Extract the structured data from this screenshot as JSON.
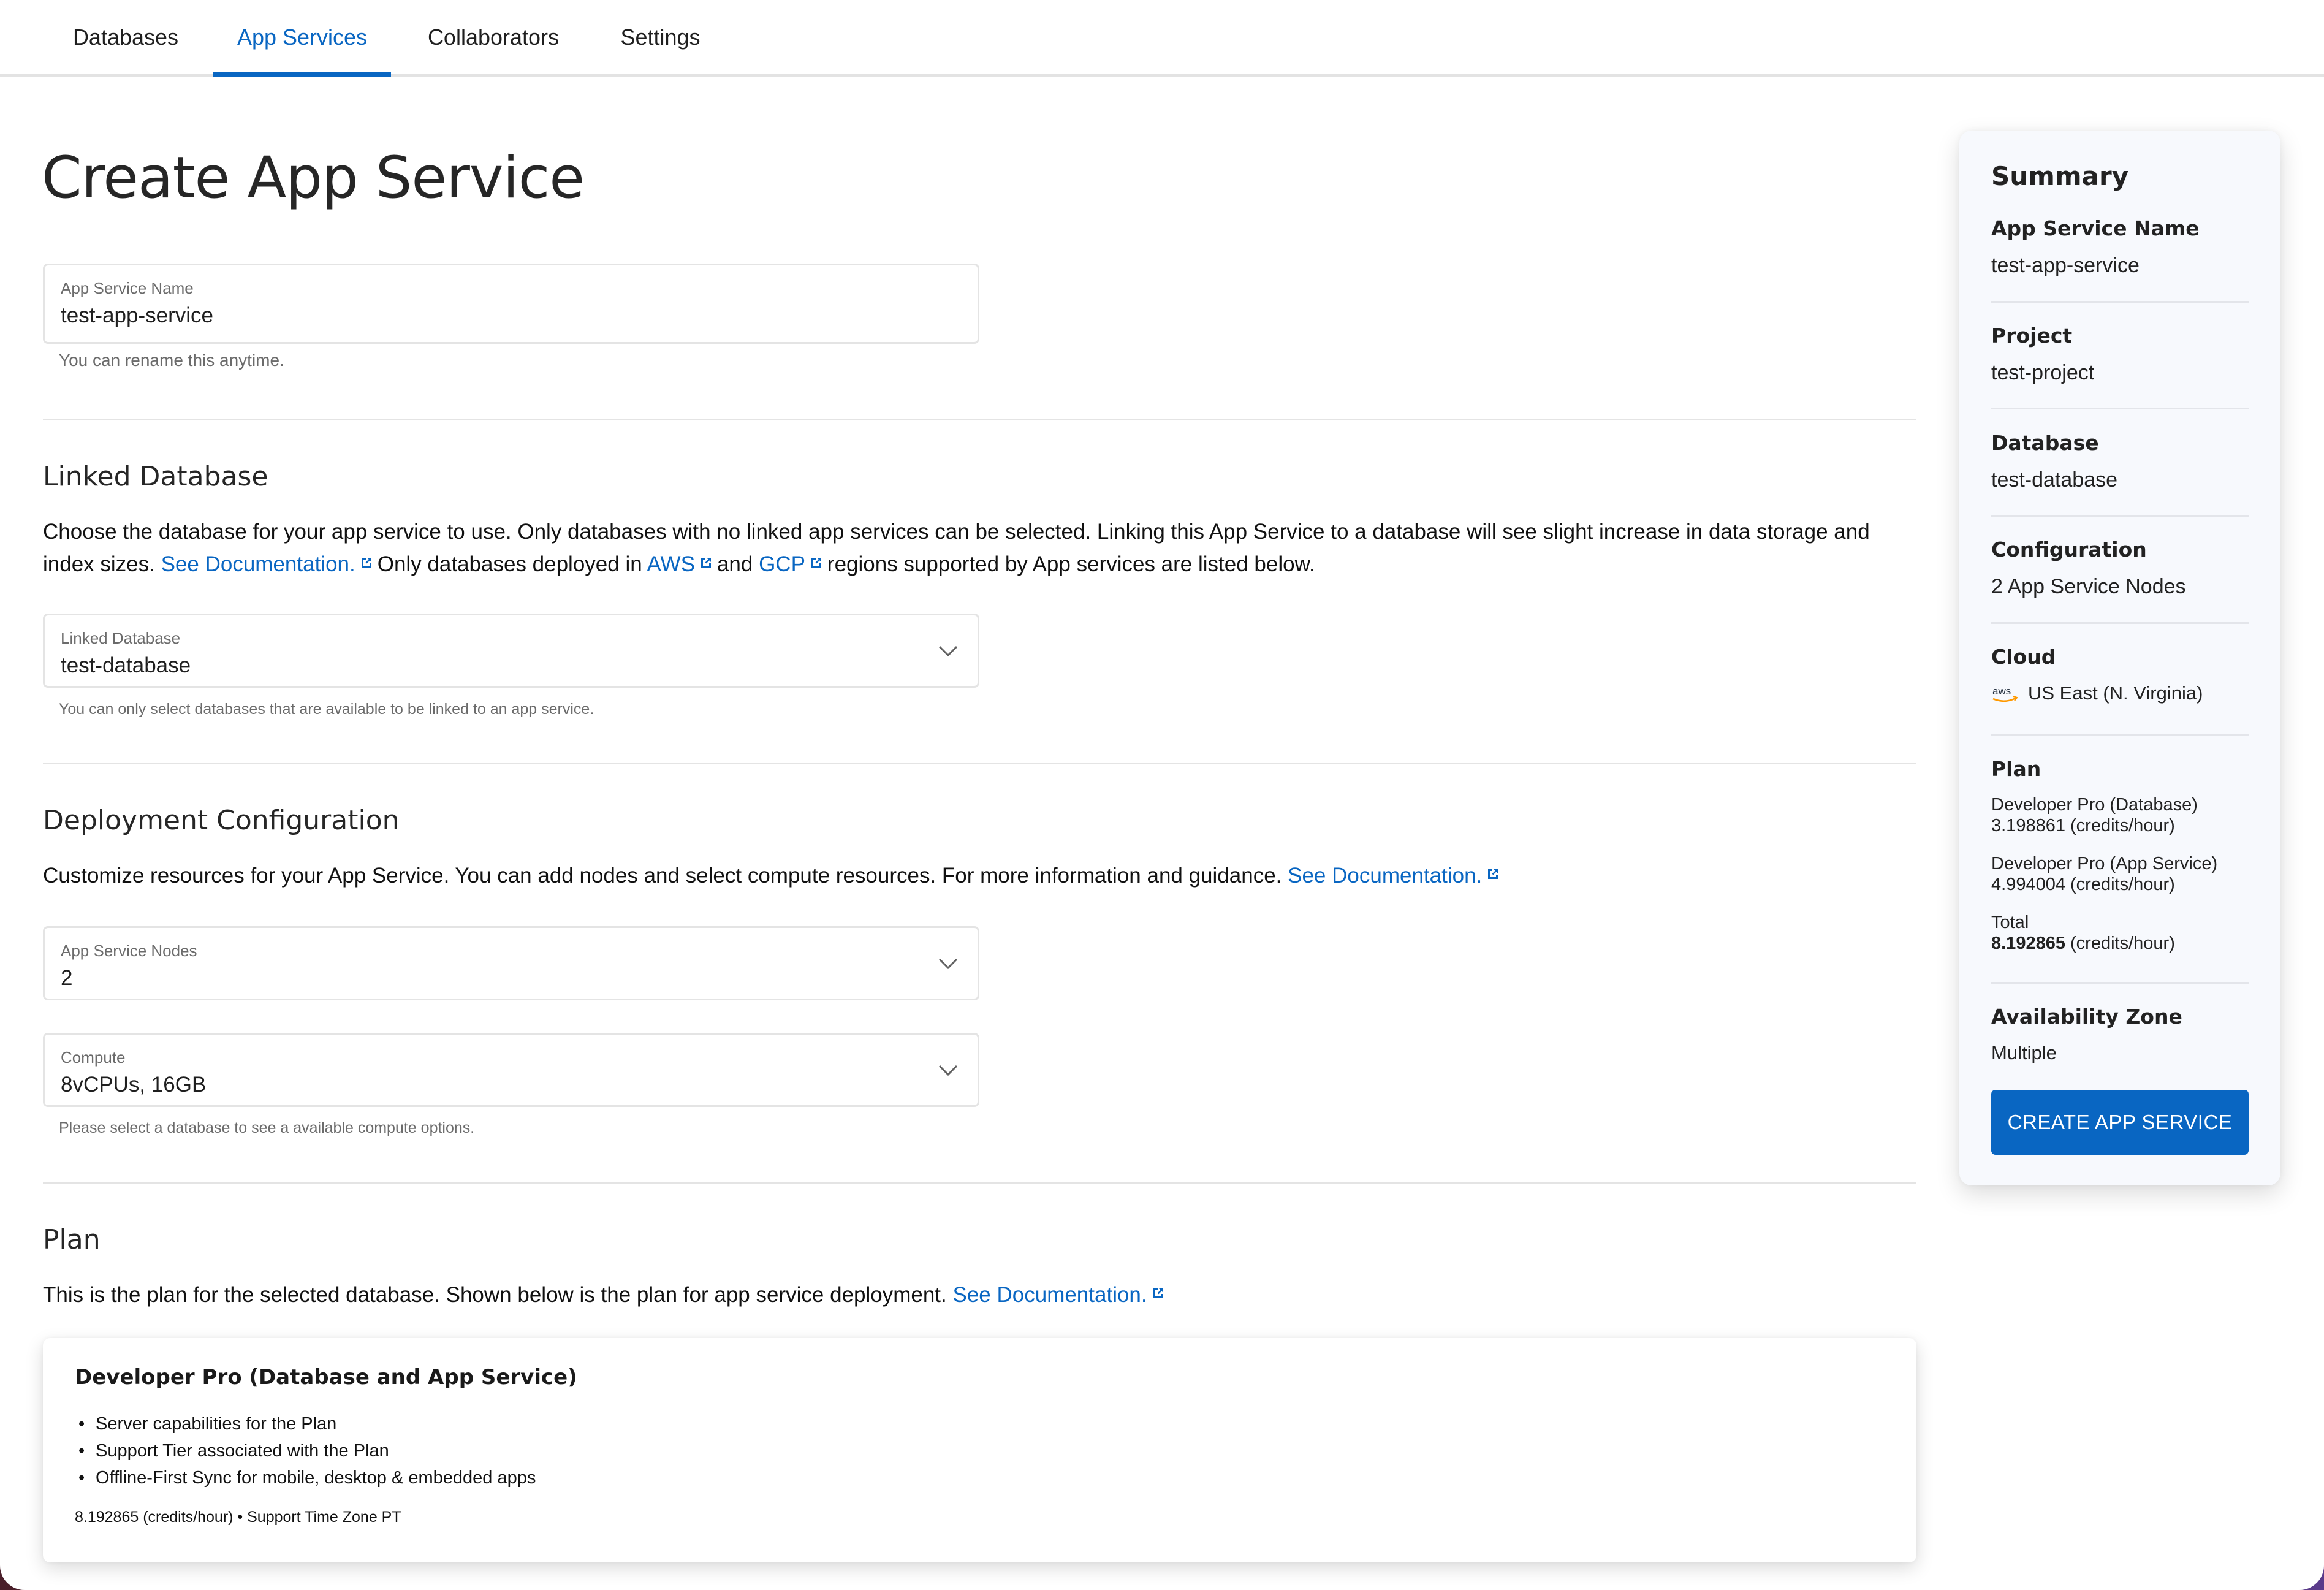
{
  "tabs": [
    {
      "label": "Databases",
      "active": false
    },
    {
      "label": "App Services",
      "active": true
    },
    {
      "label": "Collaborators",
      "active": false
    },
    {
      "label": "Settings",
      "active": false
    }
  ],
  "page_title": "Create App Service",
  "name_field": {
    "label": "App Service Name",
    "value": "test-app-service",
    "helper": "You can rename this anytime."
  },
  "linked_database": {
    "title": "Linked Database",
    "description_part1": "Choose the database for your app service to use. Only databases with no linked app services can be selected. Linking this App Service to a database will see slight increase in data storage and index sizes. ",
    "doc_link": "See Documentation.",
    "description_part2": "Only databases deployed in ",
    "aws_link": "AWS",
    "description_part3": "and ",
    "gcp_link": "GCP",
    "description_part4": "regions supported by App services are listed below.",
    "field_label": "Linked Database",
    "field_value": "test-database",
    "helper": "You can only select databases that are available to be linked to an app service."
  },
  "deployment": {
    "title": "Deployment Configuration",
    "description": "Customize resources for your App Service. You can add nodes and select compute resources. For more information and guidance. ",
    "doc_link": "See Documentation.",
    "nodes_label": "App Service Nodes",
    "nodes_value": "2",
    "compute_label": "Compute",
    "compute_value": "8vCPUs, 16GB",
    "helper": "Please select a database to see a available compute options."
  },
  "plan": {
    "title": "Plan",
    "description": "This is the plan for the selected database. Shown below is the plan for app service deployment. ",
    "doc_link": "See Documentation.",
    "card": {
      "title": "Developer Pro (Database and App Service)",
      "features": [
        "Server capabilities for the Plan",
        "Support Tier associated with the Plan",
        "Offline-First Sync for mobile, desktop & embedded apps"
      ],
      "footer": "8.192865 (credits/hour) • Support Time Zone PT"
    }
  },
  "summary": {
    "title": "Summary",
    "app_service_name_label": "App Service Name",
    "app_service_name": "test-app-service",
    "project_label": "Project",
    "project": "test-project",
    "database_label": "Database",
    "database": "test-database",
    "configuration_label": "Configuration",
    "configuration": "2 App Service Nodes",
    "cloud_label": "Cloud",
    "cloud_provider_icon": "aws-logo-icon",
    "cloud_region": "US East (N. Virginia)",
    "plan_label": "Plan",
    "plan_db_name": "Developer Pro (Database)",
    "plan_db_rate": "3.198861 (credits/hour)",
    "plan_app_name": "Developer Pro (App Service)",
    "plan_app_rate": "4.994004 (credits/hour)",
    "plan_total_label": "Total",
    "plan_total_value": "8.192865",
    "plan_total_unit": " (credits/hour)",
    "availability_zone_label": "Availability Zone",
    "availability_zone": "Multiple",
    "create_button": "CREATE APP SERVICE"
  },
  "colors": {
    "accent": "#0966c2",
    "summary_bg": "#f7f9fd",
    "divider": "#e4e4e4"
  }
}
